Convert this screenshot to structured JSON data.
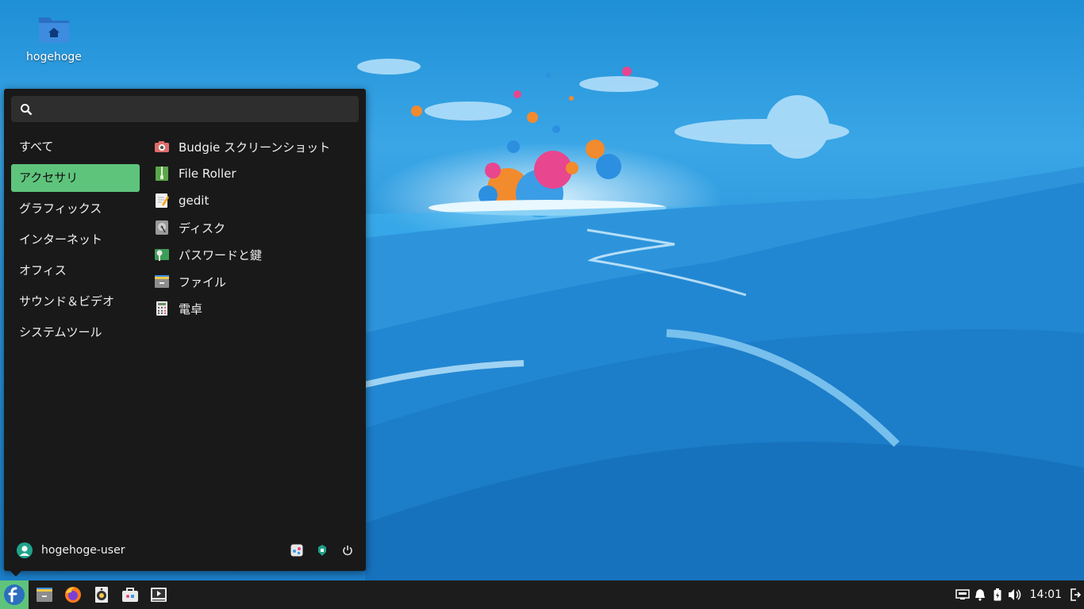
{
  "desktop": {
    "icon_label": "hogehoge"
  },
  "menu": {
    "search_placeholder": "",
    "categories": [
      "すべて",
      "アクセサリ",
      "グラフィックス",
      "インターネット",
      "オフィス",
      "サウンド＆ビデオ",
      "システムツール"
    ],
    "active_category": "アクセサリ",
    "apps": [
      {
        "label": "Budgie スクリーンショット",
        "icon": "camera-icon"
      },
      {
        "label": "File Roller",
        "icon": "archive-icon"
      },
      {
        "label": "gedit",
        "icon": "text-editor-icon"
      },
      {
        "label": "ディスク",
        "icon": "disk-icon"
      },
      {
        "label": "パスワードと鍵",
        "icon": "key-icon"
      },
      {
        "label": "ファイル",
        "icon": "file-manager-icon"
      },
      {
        "label": "電卓",
        "icon": "calculator-icon"
      }
    ],
    "user": "hogehoge-user"
  },
  "panel": {
    "clock": "14:01",
    "launcher_icon": "fedora-icon",
    "tasks": [
      "files-icon",
      "firefox-icon",
      "rhythmbox-icon",
      "software-icon",
      "video-player-icon"
    ],
    "tray": [
      "network-icon",
      "notification-bell-icon",
      "battery-icon",
      "volume-icon"
    ]
  },
  "colors": {
    "accent": "#5ec47c",
    "menu_bg": "#191919",
    "panel_bg": "#1c1c1c"
  }
}
